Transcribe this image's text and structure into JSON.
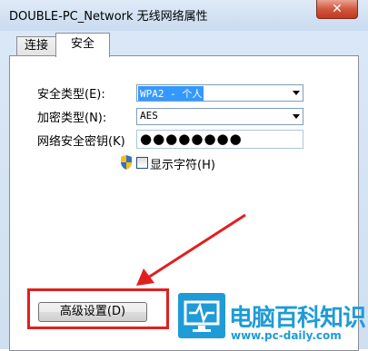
{
  "window": {
    "title": "DOUBLE-PC_Network 无线网络属性",
    "close_label": "✕"
  },
  "tabs": [
    {
      "label": "连接"
    },
    {
      "label": "安全"
    }
  ],
  "form": {
    "security_type_label": "安全类型(E):",
    "security_type_value": "WPA2 - 个人",
    "encryption_type_label": "加密类型(N):",
    "encryption_type_value": "AES",
    "key_label": "网络安全密钥(K)",
    "key_value": "●●●●●●●●",
    "show_chars_label": "显示字符(H)"
  },
  "advanced_button_label": "高级设置(D)",
  "watermark": {
    "title": "电脑百科知识",
    "url": "www.pc-daily.com"
  },
  "colors": {
    "annotation": "#e0201f",
    "watermark": "#1f9bd7"
  }
}
